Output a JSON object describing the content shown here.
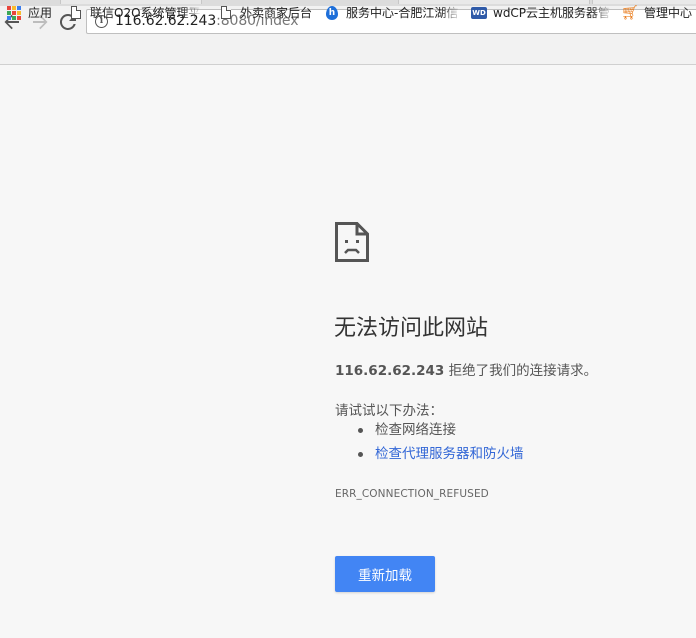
{
  "browser": {
    "url_host": "116.62.62.243",
    "url_rest": ":8080/index"
  },
  "bookmarks": [
    {
      "label": "应用",
      "icon": "apps-grid-icon"
    },
    {
      "label": "联信O2O系统管理平",
      "icon": "page-icon"
    },
    {
      "label": "外卖商家后台",
      "icon": "page-icon"
    },
    {
      "label": "服务中心-合肥江湖信",
      "icon": "blue-drop-icon"
    },
    {
      "label": "wdCP云主机服务器管",
      "icon": "wdcp-icon"
    },
    {
      "label": "管理中心",
      "icon": "cart-icon"
    }
  ],
  "error": {
    "title": "无法访问此网站",
    "host": "116.62.62.243",
    "message": " 拒绝了我们的连接请求。",
    "suggest_heading": "请试试以下办法：",
    "suggestions": [
      "检查网络连接",
      "检查代理服务器和防火墙"
    ],
    "code": "ERR_CONNECTION_REFUSED",
    "reload_label": "重新加载"
  },
  "colors": {
    "accent": "#4285f4",
    "link": "#3367d6",
    "background": "#f7f7f7"
  }
}
